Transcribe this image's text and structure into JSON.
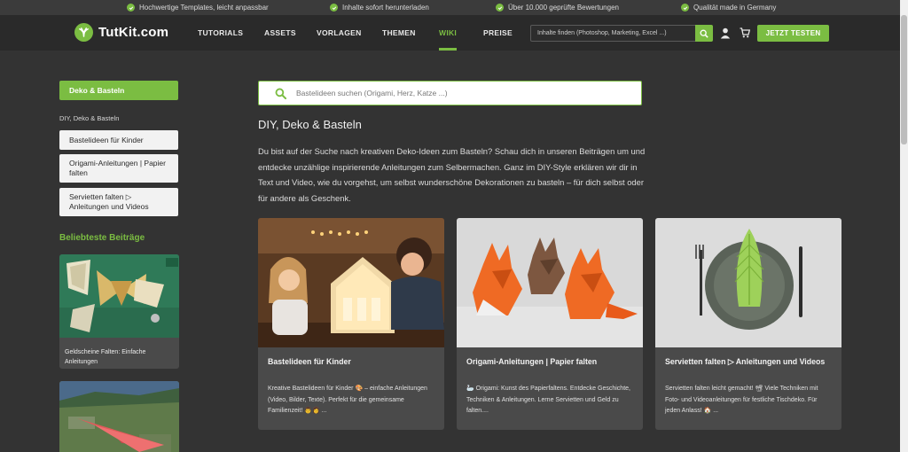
{
  "topbar": {
    "usps": [
      "Hochwertige Templates, leicht anpassbar",
      "Inhalte sofort herunterladen",
      "Über 10.000 geprüfte Bewertungen",
      "Qualität made in Germany"
    ]
  },
  "header": {
    "logo": "TutKit.com",
    "nav": [
      "TUTORIALS",
      "ASSETS",
      "VORLAGEN",
      "THEMEN",
      "WIKI",
      "PREISE"
    ],
    "active_nav": "WIKI",
    "search_placeholder": "Inhalte finden (Photoshop, Marketing, Excel ...)",
    "cta": "JETZT TESTEN"
  },
  "sidebar": {
    "active": "Deko & Basteln",
    "sub_heading": "DIY, Deko & Basteln",
    "links": [
      "Bastelideen für Kinder",
      "Origami-Anleitungen | Papier falten",
      "Servietten falten ▷ Anleitungen und Videos"
    ],
    "popular_heading": "Beliebteste Beiträge",
    "popular_posts": [
      "Geldscheine Falten: Einfache Anleitungen",
      ""
    ]
  },
  "main": {
    "search_placeholder": "Bastelideen suchen (Origami, Herz, Katze ...)",
    "title": "DIY, Deko & Basteln",
    "intro": "Du bist auf der Suche nach kreativen Deko-Ideen zum Basteln? Schau dich in unseren Beiträgen um und entdecke unzählige inspirierende Anleitungen zum Selbermachen. Ganz im DIY-Style erklären wir dir in Text und Video, wie du vorgehst, um selbst wunderschöne Dekorationen zu basteln – für dich selbst oder für andere als Geschenk.",
    "cards": [
      {
        "title": "Bastelideen für Kinder",
        "desc": "Kreative Bastelideen für Kinder 🎨 – einfache Anleitungen (Video, Bilder, Texte). Perfekt für die gemeinsame Familienzeit! 👨‍👩 ..."
      },
      {
        "title": "Origami-Anleitungen | Papier falten",
        "desc": "🦢 Origami: Kunst des Papierfaltens. Entdecke Geschichte, Techniken & Anleitungen. Lerne Servietten und Geld zu falten...."
      },
      {
        "title": "Servietten falten ▷ Anleitungen und Videos",
        "desc": "Servietten falten leicht gemacht! 📽 Viele Techniken mit Foto- und Videoanleitungen für festliche Tischdeko. Für jeden Anlass! 🏠 ..."
      }
    ]
  },
  "colors": {
    "accent": "#7bbd42",
    "page_bg": "#333333",
    "header_bg": "#2a2a2a",
    "card_bg": "#4a4a4a"
  },
  "icons": [
    "check-icon",
    "logo-icon",
    "search-icon",
    "user-icon",
    "cart-icon"
  ]
}
